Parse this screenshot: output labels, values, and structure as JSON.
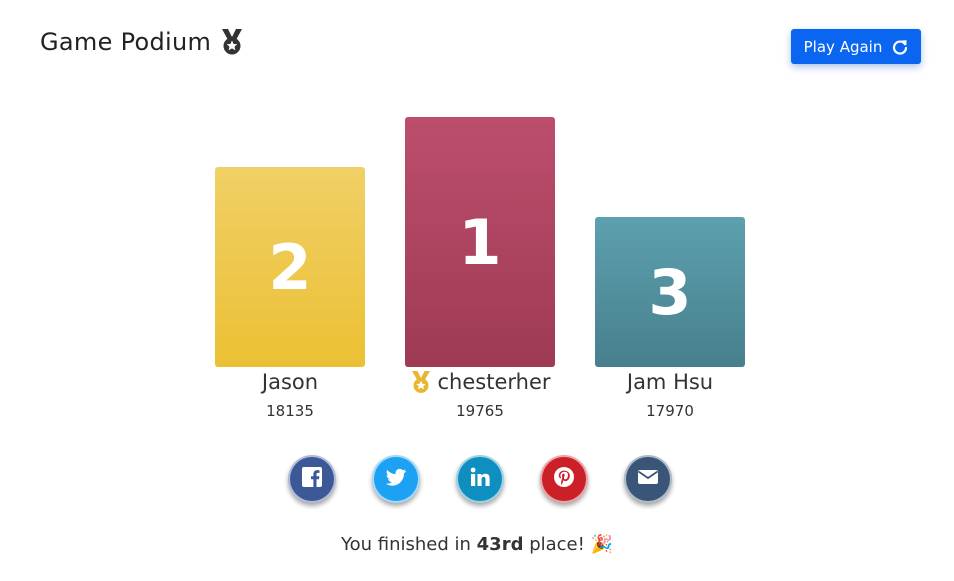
{
  "header": {
    "title": "Game Podium",
    "title_icon": "medal-icon"
  },
  "actions": {
    "play_again_label": "Play Again",
    "play_again_icon": "refresh-icon",
    "accent_color": "#0a66f0"
  },
  "podium": {
    "first": {
      "rank": "1",
      "name": "chesterher",
      "score": "19765",
      "color": "#ac4461",
      "badge_icon": "gold-medal-icon"
    },
    "second": {
      "rank": "2",
      "name": "Jason",
      "score": "18135",
      "color": "#eec84d"
    },
    "third": {
      "rank": "3",
      "name": "Jam Hsu",
      "score": "17970",
      "color": "#528f9e"
    }
  },
  "share": [
    {
      "icon": "facebook-icon",
      "color": "#3b5998"
    },
    {
      "icon": "twitter-icon",
      "color": "#1da1f2"
    },
    {
      "icon": "linkedin-icon",
      "color": "#0e8fc0"
    },
    {
      "icon": "pinterest-icon",
      "color": "#cb2027"
    },
    {
      "icon": "email-icon",
      "color": "#3b5578"
    }
  ],
  "result": {
    "prefix": "You finished in",
    "place": "43rd",
    "suffix": "place!",
    "emoji": "🎉"
  }
}
